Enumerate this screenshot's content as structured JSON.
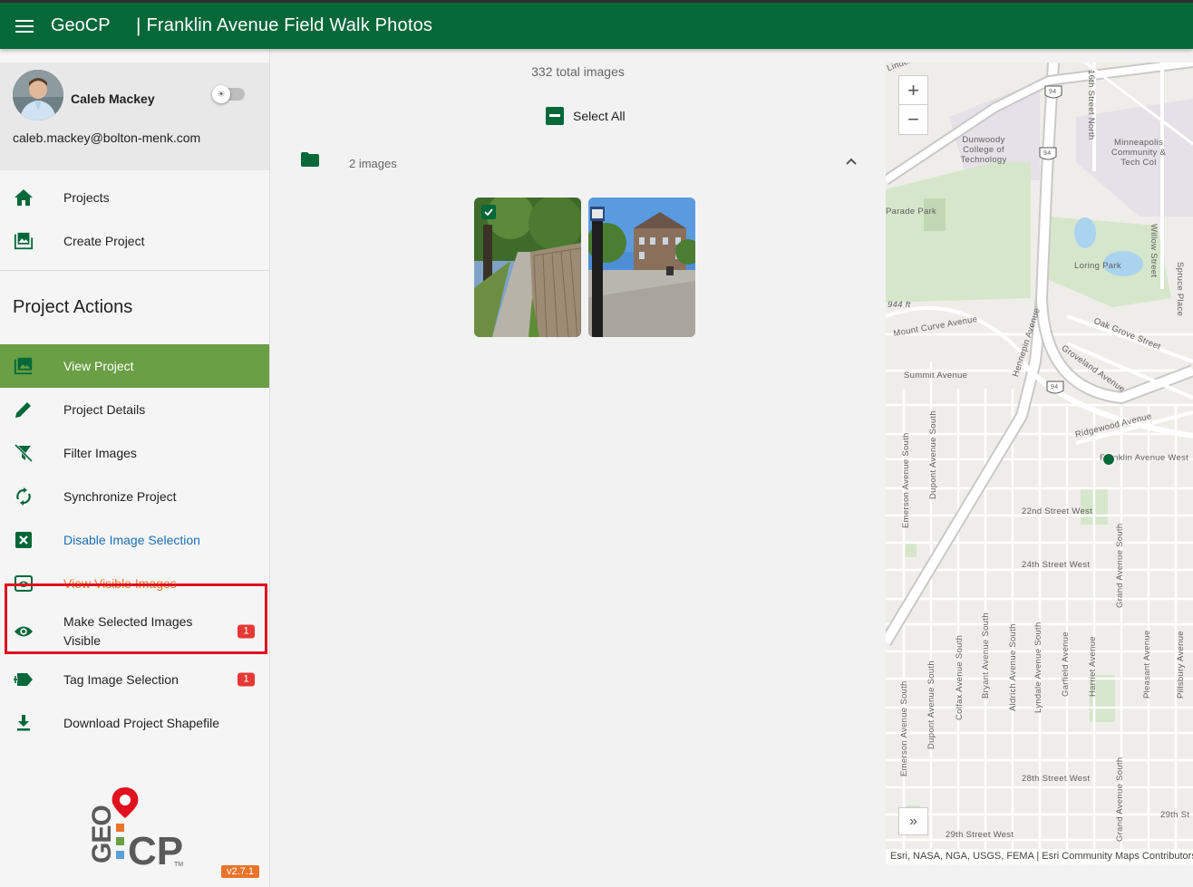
{
  "header": {
    "brand": "GeoCP",
    "separator": "|",
    "project_title": "Franklin Avenue Field Walk Photos"
  },
  "user": {
    "name": "Caleb Mackey",
    "email": "caleb.mackey@bolton-menk.com"
  },
  "nav_main": [
    {
      "label": "Projects",
      "icon": "home-icon"
    },
    {
      "label": "Create Project",
      "icon": "image-add-icon"
    }
  ],
  "section_title": "Project Actions",
  "actions": [
    {
      "label": "View Project",
      "icon": "image-icon",
      "state": "active"
    },
    {
      "label": "Project Details",
      "icon": "pencil-icon"
    },
    {
      "label": "Filter Images",
      "icon": "filter-off-icon"
    },
    {
      "label": "Synchronize Project",
      "icon": "sync-icon"
    },
    {
      "label": "Disable Image Selection",
      "icon": "close-box-icon",
      "color": "#1c6fb5"
    },
    {
      "label": "View Visible Images",
      "icon": "eye-box-icon",
      "color": "#e8742b"
    },
    {
      "label": "Make Selected Images Visible",
      "icon": "eye-icon",
      "badge": "1"
    },
    {
      "label": "Tag Image Selection",
      "icon": "tag-plus-icon",
      "badge": "1"
    },
    {
      "label": "Download Project Shapefile",
      "icon": "download-icon"
    }
  ],
  "version": "v2.7.1",
  "logo": {
    "text_geo": "GEO",
    "text_cp": "CP",
    "tm": "TM"
  },
  "gallery": {
    "total": "332 total images",
    "select_all": "Select All",
    "folder_count": "2 images"
  },
  "map": {
    "attribution": "Esri, NASA, NGA, USGS, FEMA | Esri Community Maps Contributors",
    "labels": {
      "dunwoody": "Dunwoody College of Technology",
      "mctc": "Minneapolis Community & Tech Col",
      "parade": "Parade Park",
      "loring": "Loring Park",
      "elevation": "944 ft",
      "mount_curve": "Mount Curve Avenue",
      "summit": "Summit Avenue",
      "oak_grove": "Oak Grove Street",
      "groveland": "Groveland Avenue",
      "ridgewood": "Ridgewood Avenue",
      "franklin": "Franklin Avenue West",
      "st22": "22nd Street West",
      "st24": "24th Street West",
      "st28": "28th Street West",
      "st29": "29th Street West",
      "st29b": "29th St",
      "hennepin": "Hennepin Avenue",
      "emerson": "Emerson Avenue South",
      "dupont": "Dupont Avenue South",
      "colfax": "Colfax Avenue South",
      "bryant": "Bryant Avenue South",
      "aldrich": "Aldrich Avenue South",
      "lyndale": "Lyndale Avenue South",
      "garfield": "Garfield Avenue",
      "harriet": "Harriet Avenue",
      "grand": "Grand Avenue South",
      "pleasant": "Pleasant Avenue",
      "pillsbury": "Pillsbury Avenue",
      "willow": "Willow Street",
      "spruce": "Spruce Place",
      "sixteenth": "16th Street North",
      "linden": "Linden Avenue",
      "i94": "94"
    }
  }
}
